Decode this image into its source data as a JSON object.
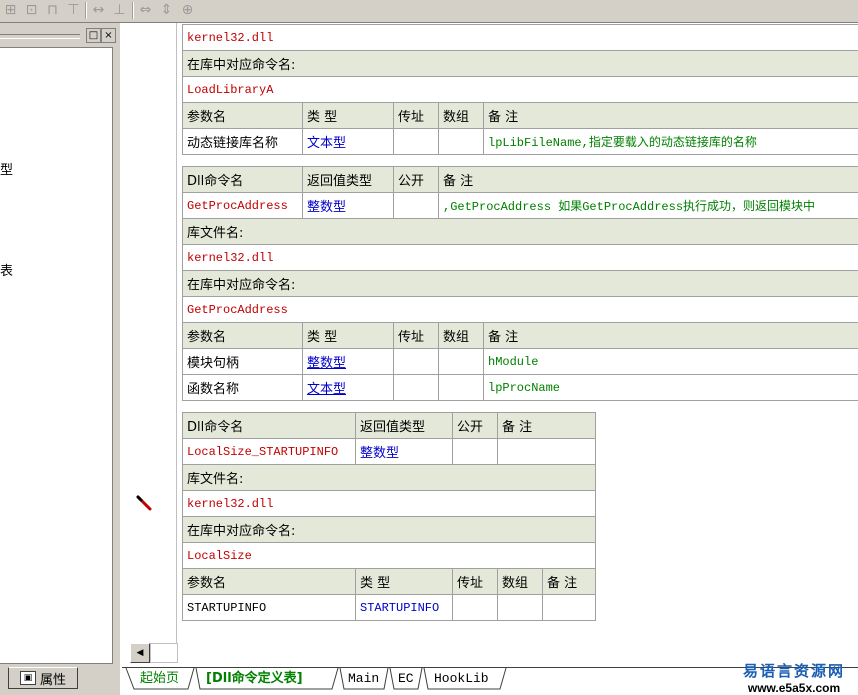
{
  "left_panel": {
    "fragments": [
      "型",
      "表"
    ],
    "properties_tab": "属性"
  },
  "block1": {
    "lib_file": "kernel32.dll",
    "lib_cmd_label": "在库中对应命令名:",
    "lib_cmd": "LoadLibraryA",
    "param_headers": [
      "参数名",
      "类 型",
      "传址",
      "数组",
      "备 注"
    ],
    "params": [
      {
        "name": "动态链接库名称",
        "type": "文本型",
        "note": "lpLibFileName,指定要载入的动态链接库的名称"
      }
    ]
  },
  "block2": {
    "cmd_headers": [
      "Dll命令名",
      "返回值类型",
      "公开",
      "备 注"
    ],
    "cmd": {
      "name": "GetProcAddress",
      "ret": "整数型",
      "note": ",GetProcAddress 如果GetProcAddress执行成功，则返回模块中"
    },
    "lib_file_label": "库文件名:",
    "lib_file": "kernel32.dll",
    "lib_cmd_label": "在库中对应命令名:",
    "lib_cmd": "GetProcAddress",
    "param_headers": [
      "参数名",
      "类 型",
      "传址",
      "数组",
      "备 注"
    ],
    "params": [
      {
        "name": "模块句柄",
        "type": "整数型",
        "note": "hModule"
      },
      {
        "name": "函数名称",
        "type": "文本型",
        "note": "lpProcName"
      }
    ]
  },
  "block3": {
    "cmd_headers": [
      "Dll命令名",
      "返回值类型",
      "公开",
      "备 注"
    ],
    "cmd": {
      "name": "LocalSize_STARTUPINFO",
      "ret": "整数型",
      "note": ""
    },
    "lib_file_label": "库文件名:",
    "lib_file": "kernel32.dll",
    "lib_cmd_label": "在库中对应命令名:",
    "lib_cmd": "LocalSize",
    "param_headers": [
      "参数名",
      "类 型",
      "传址",
      "数组",
      "备 注"
    ],
    "params": [
      {
        "name": "STARTUPINFO",
        "type": "STARTUPINFO",
        "note": ""
      }
    ]
  },
  "tabs": [
    "起始页",
    "[Dll命令定义表]",
    "Main",
    "EC",
    "HookLib"
  ],
  "watermark": {
    "line1": "易语言资源网",
    "line2": "www.e5a5x.com"
  },
  "colors": {
    "lib_text": "#c00000",
    "type_text": "#0000cc",
    "note_text": "#008000",
    "header_bg": "#e4e8d8",
    "tab_active": "#008000"
  }
}
